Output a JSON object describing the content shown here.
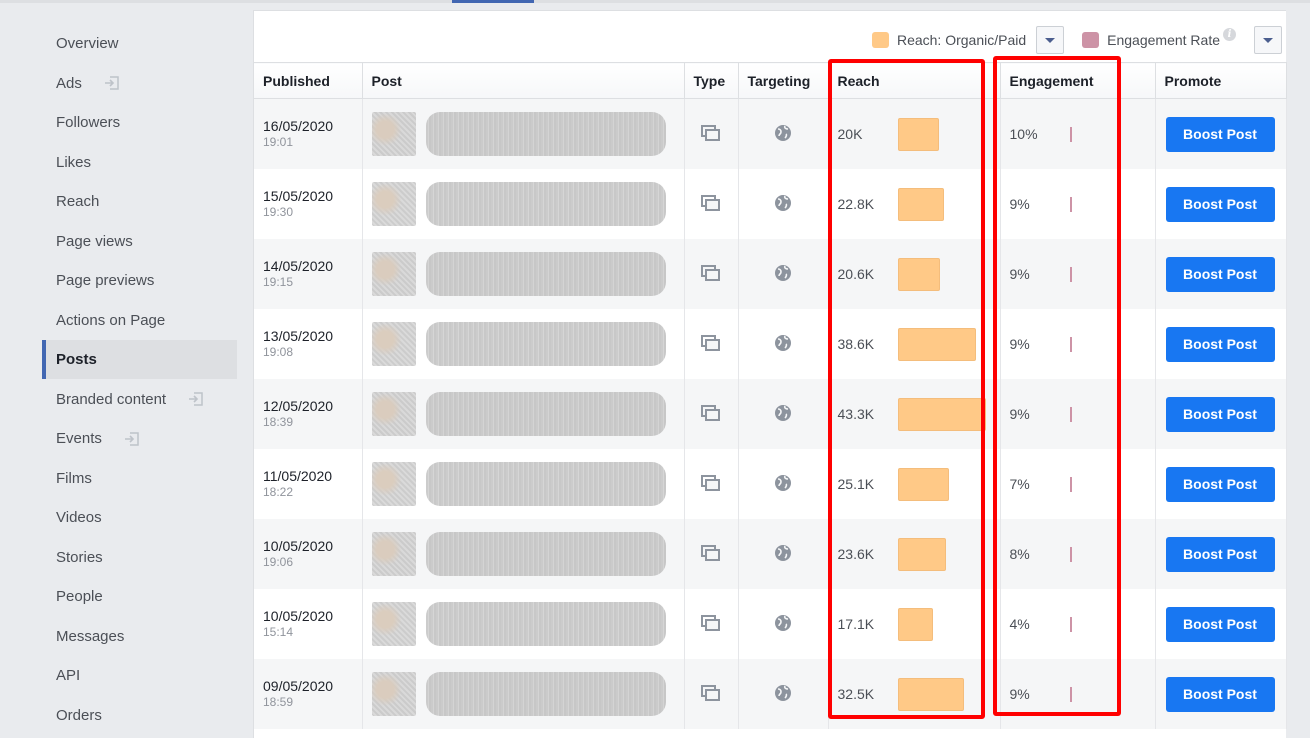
{
  "sidebar": {
    "items": [
      {
        "label": "Overview",
        "external": false,
        "active": false
      },
      {
        "label": "Ads",
        "external": true,
        "active": false
      },
      {
        "label": "Followers",
        "external": false,
        "active": false
      },
      {
        "label": "Likes",
        "external": false,
        "active": false
      },
      {
        "label": "Reach",
        "external": false,
        "active": false
      },
      {
        "label": "Page views",
        "external": false,
        "active": false
      },
      {
        "label": "Page previews",
        "external": false,
        "active": false
      },
      {
        "label": "Actions on Page",
        "external": false,
        "active": false
      },
      {
        "label": "Posts",
        "external": false,
        "active": true
      },
      {
        "label": "Branded content",
        "external": true,
        "active": false
      },
      {
        "label": "Events",
        "external": true,
        "active": false
      },
      {
        "label": "Films",
        "external": false,
        "active": false
      },
      {
        "label": "Videos",
        "external": false,
        "active": false
      },
      {
        "label": "Stories",
        "external": false,
        "active": false
      },
      {
        "label": "People",
        "external": false,
        "active": false
      },
      {
        "label": "Messages",
        "external": false,
        "active": false
      },
      {
        "label": "API",
        "external": false,
        "active": false
      },
      {
        "label": "Orders",
        "external": false,
        "active": false
      }
    ]
  },
  "legend": {
    "reach_label": "Reach: Organic/Paid",
    "reach_color": "#ffc987",
    "engagement_label": "Engagement Rate",
    "engagement_color": "#cd93a6",
    "info_glyph": "i"
  },
  "table": {
    "columns": [
      "Published",
      "Post",
      "Type",
      "Targeting",
      "Reach",
      "Engagement",
      "Promote"
    ],
    "boost_label": "Boost Post",
    "type_icon": "multi-photo-icon",
    "targeting_icon": "globe-icon",
    "reach_max": 43300,
    "rows": [
      {
        "date": "16/05/2020",
        "time": "19:01",
        "reach": "20K",
        "reach_value": 20000,
        "engagement": "10%"
      },
      {
        "date": "15/05/2020",
        "time": "19:30",
        "reach": "22.8K",
        "reach_value": 22800,
        "engagement": "9%"
      },
      {
        "date": "14/05/2020",
        "time": "19:15",
        "reach": "20.6K",
        "reach_value": 20600,
        "engagement": "9%"
      },
      {
        "date": "13/05/2020",
        "time": "19:08",
        "reach": "38.6K",
        "reach_value": 38600,
        "engagement": "9%"
      },
      {
        "date": "12/05/2020",
        "time": "18:39",
        "reach": "43.3K",
        "reach_value": 43300,
        "engagement": "9%"
      },
      {
        "date": "11/05/2020",
        "time": "18:22",
        "reach": "25.1K",
        "reach_value": 25100,
        "engagement": "7%"
      },
      {
        "date": "10/05/2020",
        "time": "19:06",
        "reach": "23.6K",
        "reach_value": 23600,
        "engagement": "8%"
      },
      {
        "date": "10/05/2020",
        "time": "15:14",
        "reach": "17.1K",
        "reach_value": 17100,
        "engagement": "4%"
      },
      {
        "date": "09/05/2020",
        "time": "18:59",
        "reach": "32.5K",
        "reach_value": 32500,
        "engagement": "9%"
      }
    ]
  },
  "annotations": {
    "highlight_color": "#ff0000",
    "highlighted_columns": [
      "Reach",
      "Engagement"
    ]
  }
}
